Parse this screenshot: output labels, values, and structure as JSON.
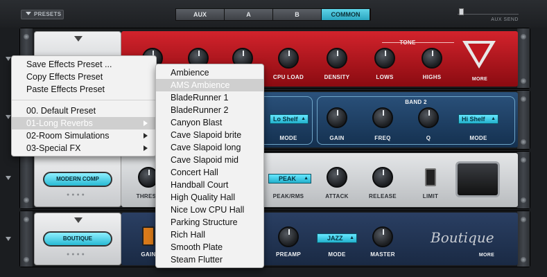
{
  "top": {
    "presets_label": "PRESETS",
    "tabs": [
      "AUX",
      "A",
      "B",
      "COMMON"
    ],
    "active_tab": "COMMON",
    "aux_send_label": "AUX SEND"
  },
  "reverb": {
    "knob_labels": [
      "CPU LOAD",
      "DENSITY",
      "LOWS",
      "HIGHS"
    ],
    "tone_label": "TONE",
    "more_label": "MORE"
  },
  "eq": {
    "band_label": "BAND 2",
    "shelf_low": "Lo Shelf",
    "shelf_high": "Hi Shelf",
    "knob_labels": [
      "GAIN",
      "FREQ",
      "Q"
    ],
    "mode_label": "MODE"
  },
  "comp": {
    "preset_name": "MODERN COMP",
    "thresh_label": "THRESH",
    "peak_value": "PEAK",
    "labels": [
      "PEAK/RMS",
      "ATTACK",
      "RELEASE",
      "LIMIT"
    ]
  },
  "boutique": {
    "preset_name": "BOUTIQUE",
    "gain_label": "GAIN",
    "jazz_value": "JAZZ",
    "labels": [
      "PREAMP",
      "MODE",
      "MASTER"
    ],
    "logo_text": "Boutique",
    "more_label": "MORE"
  },
  "context_menu": {
    "items": [
      "Save Effects Preset ...",
      "Copy Effects Preset",
      "Paste Effects Preset"
    ],
    "categories": [
      "00. Default Preset",
      "01-Long Reverbs",
      "02-Room Simulations",
      "03-Special FX"
    ],
    "highlighted": "01-Long Reverbs"
  },
  "submenu": {
    "items": [
      "Ambience",
      "AMS Ambience",
      "BladeRunner 1",
      "BladeRunner 2",
      "Canyon Blast",
      "Cave Slapoid brite",
      "Cave Slapoid long",
      "Cave Slapoid mid",
      "Concert Hall",
      "Handball Court",
      "High Quality Hall",
      "Nice Low CPU Hall",
      "Parking Structure",
      "Rich Hall",
      "Smooth Plate",
      "Steam Flutter"
    ],
    "highlighted": "AMS Ambience"
  },
  "colors": {
    "accent": "#2aa6c0",
    "reverb_red": "#b5121b",
    "eq_blue": "#1f3f66"
  }
}
